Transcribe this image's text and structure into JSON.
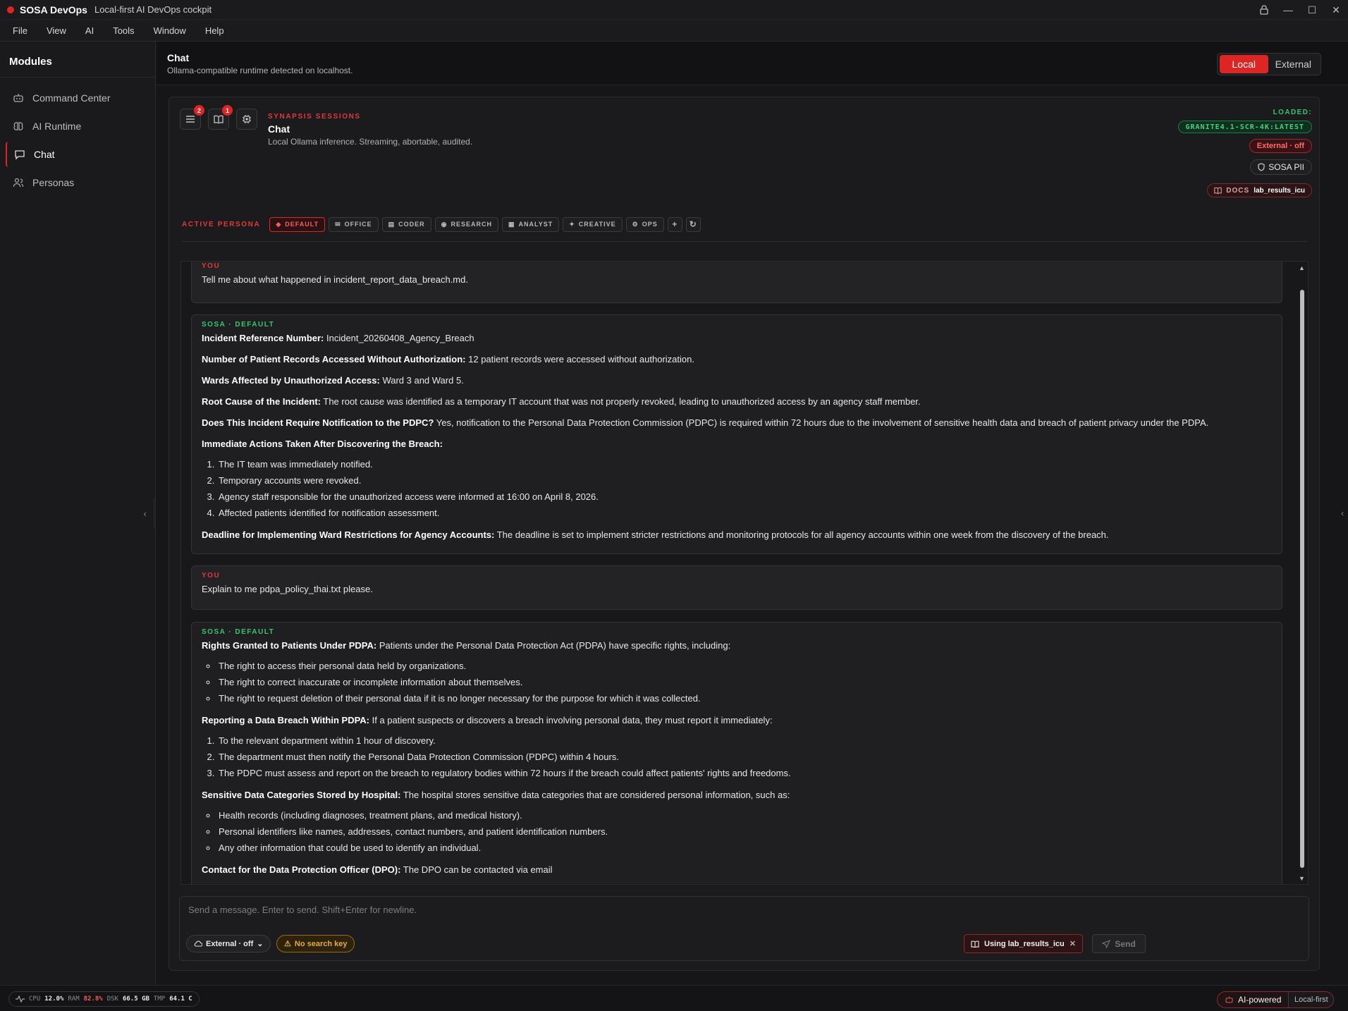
{
  "titlebar": {
    "app_name": "SOSA DevOps",
    "tagline": "Local-first AI DevOps cockpit"
  },
  "menu": [
    "File",
    "View",
    "AI",
    "Tools",
    "Window",
    "Help"
  ],
  "sidebar": {
    "title": "Modules",
    "items": [
      {
        "label": "Command Center",
        "icon": "robot-icon"
      },
      {
        "label": "AI Runtime",
        "icon": "brain-icon"
      },
      {
        "label": "Chat",
        "icon": "chat-bubble-icon",
        "active": true
      },
      {
        "label": "Personas",
        "icon": "users-icon"
      }
    ]
  },
  "header": {
    "title": "Chat",
    "subtitle": "Ollama-compatible runtime detected on localhost.",
    "mode_local": "Local",
    "mode_external": "External"
  },
  "session": {
    "badge_menu": "2",
    "badge_book": "1",
    "kicker": "SYNAPSIS SESSIONS",
    "title": "Chat",
    "subtitle": "Local Ollama inference. Streaming, abortable, audited.",
    "loaded_label": "LOADED:",
    "model": "GRANITE4.1-SCR-4K:LATEST",
    "external": "External · off",
    "pii": "SOSA PII",
    "docs_label": "DOCS",
    "docs_value": "lab_results_icu"
  },
  "personas": {
    "label": "ACTIVE PERSONA",
    "items": [
      "DEFAULT",
      "OFFICE",
      "CODER",
      "RESEARCH",
      "ANALYST",
      "CREATIVE",
      "OPS"
    ]
  },
  "messages": {
    "m1": {
      "who": "YOU",
      "text": "Tell me about what happened in incident_report_data_breach.md."
    },
    "m2": {
      "who": "SOSA · DEFAULT",
      "l1k": "Incident Reference Number:",
      "l1v": " Incident_20260408_Agency_Breach",
      "l2k": "Number of Patient Records Accessed Without Authorization:",
      "l2v": " 12 patient records were accessed without authorization.",
      "l3k": "Wards Affected by Unauthorized Access:",
      "l3v": " Ward 3 and Ward 5.",
      "l4k": "Root Cause of the Incident:",
      "l4v": " The root cause was identified as a temporary IT account that was not properly revoked, leading to unauthorized access by an agency staff member.",
      "l5k": "Does This Incident Require Notification to the PDPC?",
      "l5v": " Yes, notification to the Personal Data Protection Commission (PDPC) is required within 72 hours due to the involvement of sensitive health data and breach of patient privacy under the PDPA.",
      "l6k": "Immediate Actions Taken After Discovering the Breach:",
      "actions": [
        "The IT team was immediately notified.",
        "Temporary accounts were revoked.",
        "Agency staff responsible for the unauthorized access were informed at 16:00 on April 8, 2026.",
        "Affected patients identified for notification assessment."
      ],
      "l7k": "Deadline for Implementing Ward Restrictions for Agency Accounts:",
      "l7v": " The deadline is set to implement stricter restrictions and monitoring protocols for all agency accounts within one week from the discovery of the breach."
    },
    "m3": {
      "who": "YOU",
      "text": "Explain to me pdpa_policy_thai.txt please."
    },
    "m4": {
      "who": "SOSA · DEFAULT",
      "l1k": "Rights Granted to Patients Under PDPA:",
      "l1v": " Patients under the Personal Data Protection Act (PDPA) have specific rights, including:",
      "rights": [
        "The right to access their personal data held by organizations.",
        "The right to correct inaccurate or incomplete information about themselves.",
        "The right to request deletion of their personal data if it is no longer necessary for the purpose for which it was collected."
      ],
      "l2k": "Reporting a Data Breach Within PDPA:",
      "l2v": " If a patient suspects or discovers a breach involving personal data, they must report it immediately:",
      "steps": [
        "To the relevant department within 1 hour of discovery.",
        "The department must then notify the Personal Data Protection Commission (PDPC) within 4 hours.",
        "The PDPC must assess and report on the breach to regulatory bodies within 72 hours if the breach could affect patients' rights and freedoms."
      ],
      "l3k": "Sensitive Data Categories Stored by Hospital:",
      "l3v": " The hospital stores sensitive data categories that are considered personal information, such as:",
      "cats": [
        "Health records (including diagnoses, treatment plans, and medical history).",
        "Personal identifiers like names, addresses, contact numbers, and patient identification numbers.",
        "Any other information that could be used to identify an individual."
      ],
      "l4k": "Contact for the Data Protection Officer (DPO):",
      "l4v": " The DPO can be contacted via email"
    }
  },
  "composer": {
    "placeholder": "Send a message. Enter to send. Shift+Enter for newline.",
    "external": "External · off",
    "no_key": "No search key",
    "using": "Using lab_results_icu",
    "send": "Send"
  },
  "status": {
    "cpu_label": "CPU",
    "cpu": "12.0%",
    "ram_label": "RAM",
    "ram": "82.8%",
    "dsk_label": "DSK",
    "dsk": "66.5 GB",
    "tmp_label": "TMP",
    "tmp": "64.1 C",
    "ai": "AI-powered",
    "local": "Local-first"
  },
  "colors": {
    "accent": "#dc2626",
    "success": "#34c76f",
    "warning": "#e8a93c"
  }
}
